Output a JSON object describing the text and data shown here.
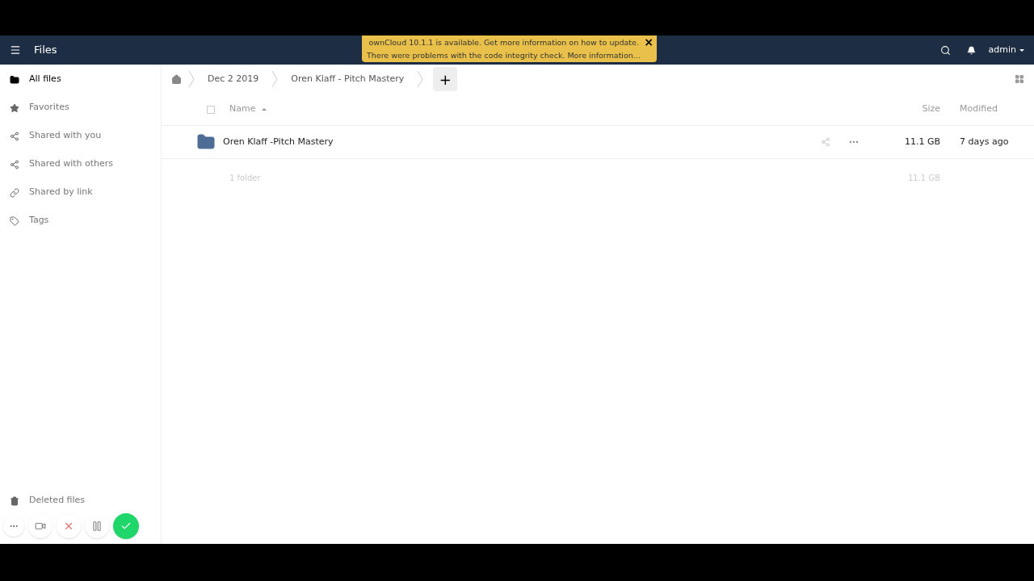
{
  "header": {
    "app_title": "Files",
    "user": "admin"
  },
  "notification": {
    "lines": [
      "ownCloud 10.1.1 is available. Get more information on how to update.",
      "There were problems with the code integrity check. More information…"
    ],
    "close": "×"
  },
  "sidebar": {
    "items": [
      {
        "kind": "folder",
        "label": "All files",
        "selected": true
      },
      {
        "kind": "star",
        "label": "Favorites",
        "selected": false
      },
      {
        "kind": "share",
        "label": "Shared with you",
        "selected": false
      },
      {
        "kind": "share",
        "label": "Shared with others",
        "selected": false
      },
      {
        "kind": "link",
        "label": "Shared by link",
        "selected": false
      },
      {
        "kind": "tag",
        "label": "Tags",
        "selected": false
      }
    ],
    "bottom": [
      {
        "kind": "trash",
        "label": "Deleted files"
      }
    ]
  },
  "breadcrumbs": [
    "Dec 2 2019",
    "Oren Klaff - Pitch Mastery"
  ],
  "new_button": "+",
  "table": {
    "select_all_checked": false,
    "columns": [
      "Name",
      "Size",
      "Modified"
    ],
    "rows": [
      {
        "name": "Oren Klaff -Pitch Mastery",
        "size": "11.1 GB",
        "modified": "7 days ago"
      }
    ],
    "summary": {
      "count": "1 folder",
      "size": "11.1 GB"
    }
  }
}
